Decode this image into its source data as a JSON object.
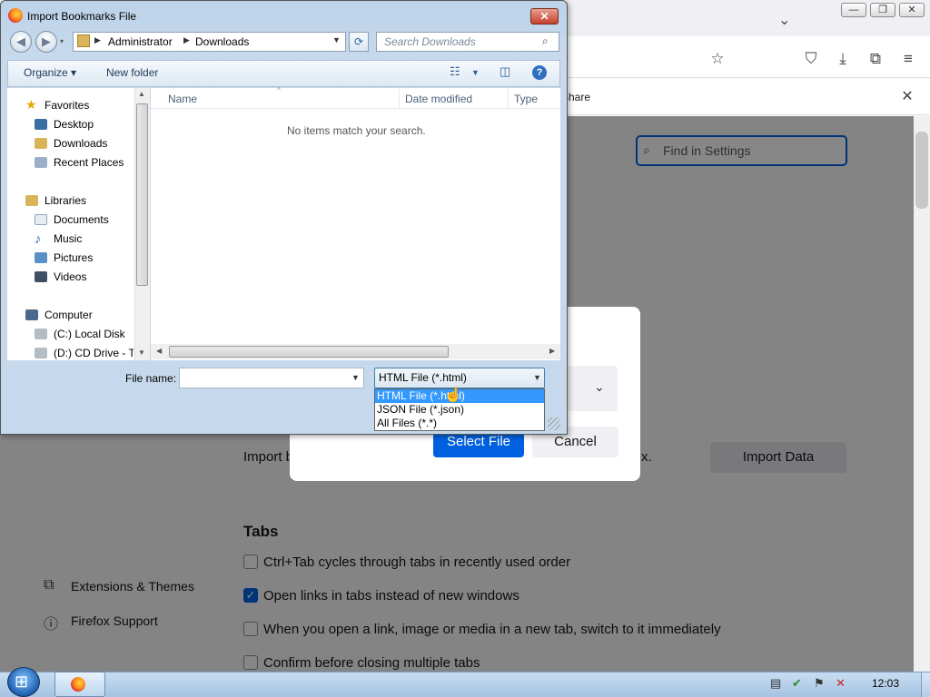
{
  "firefox": {
    "window_buttons": {
      "minimize": "—",
      "maximize": "❐",
      "close": "✕"
    },
    "tab_list_chevron": "⌄",
    "toolbar_icons": [
      "bookmark-star-icon",
      "pocket-icon",
      "downloads-icon",
      "extensions-icon",
      "menu-icon"
    ],
    "notice": {
      "share_label": "Share",
      "close": "✕"
    },
    "find_placeholder": "Find in Settings",
    "import_text_start": "Import b",
    "import_text_end": "x.",
    "import_data_label": "Import Data",
    "tabs_heading": "Tabs",
    "tab_settings": [
      {
        "label": "Ctrl+Tab cycles through tabs in recently used order",
        "checked": false
      },
      {
        "label": "Open links in tabs instead of new windows",
        "checked": true
      },
      {
        "label": "When you open a link, image or media in a new tab, switch to it immediately",
        "checked": false
      },
      {
        "label": "Confirm before closing multiple tabs",
        "checked": false
      }
    ],
    "sidebar": {
      "extensions_label": "Extensions & Themes",
      "support_label": "Firefox Support"
    },
    "modal": {
      "select_file_label": "Select File",
      "cancel_label": "Cancel"
    }
  },
  "dialog": {
    "title": "Import Bookmarks File",
    "address": {
      "crumbs": [
        "Administrator",
        "Downloads"
      ]
    },
    "search_placeholder": "Search Downloads",
    "toolbar": {
      "organize_label": "Organize",
      "new_folder_label": "New folder"
    },
    "nav": {
      "favorites_label": "Favorites",
      "favorites": [
        "Desktop",
        "Downloads",
        "Recent Places"
      ],
      "libraries_label": "Libraries",
      "libraries": [
        "Documents",
        "Music",
        "Pictures",
        "Videos"
      ],
      "computer_label": "Computer",
      "drives": [
        "(C:) Local Disk",
        "(D:) CD Drive - Ti"
      ]
    },
    "columns": [
      "Name",
      "Date modified",
      "Type"
    ],
    "empty_message": "No items match your search.",
    "file_name_label": "File name:",
    "file_name_value": "",
    "file_type_selected": "HTML File (*.html)",
    "file_type_options": [
      "HTML File (*.html)",
      "JSON File (*.json)",
      "All Files (*.*)"
    ]
  },
  "taskbar": {
    "clock": "12:03"
  }
}
